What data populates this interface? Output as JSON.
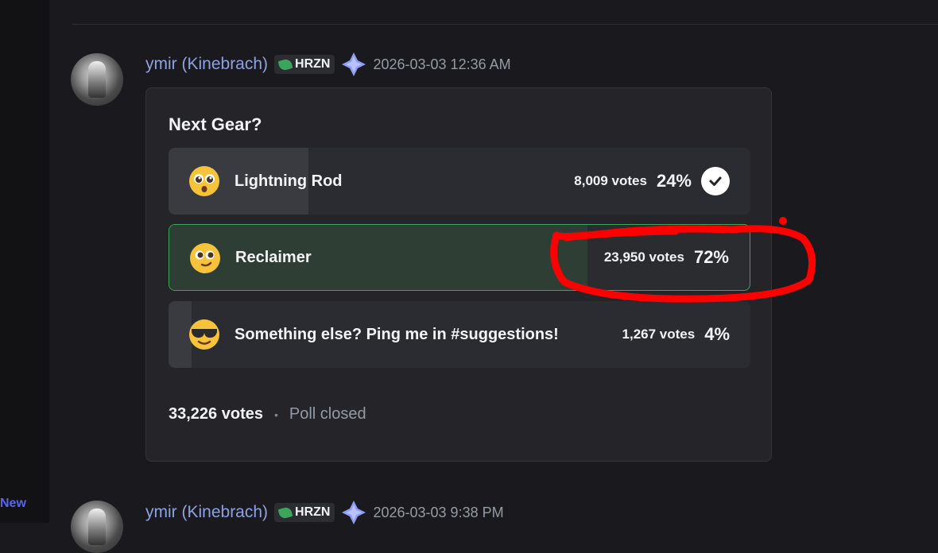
{
  "sidebar": {
    "new_label": "New"
  },
  "messages": [
    {
      "username": "ymir (Kinebrach)",
      "tag": "HRZN",
      "timestamp": "2026-03-03 12:36 AM"
    },
    {
      "username": "ymir (Kinebrach)",
      "tag": "HRZN",
      "timestamp": "2026-03-03 9:38 PM"
    }
  ],
  "poll": {
    "question": "Next Gear?",
    "answers": [
      {
        "emoji": "pleading-face-icon",
        "label": "Lightning Rod",
        "votes": "8,009 votes",
        "percent": "24%",
        "fraction": 0.24,
        "selected_by_user": true
      },
      {
        "emoji": "smiling-face-icon",
        "label": "Reclaimer",
        "votes": "23,950 votes",
        "percent": "72%",
        "fraction": 0.72,
        "winner": true
      },
      {
        "emoji": "sunglasses-face-icon",
        "label": "Something else? Ping me in #suggestions!",
        "votes": "1,267 votes",
        "percent": "4%",
        "fraction": 0.04
      }
    ],
    "total_votes": "33,226 votes",
    "separator": "•",
    "status": "Poll closed"
  },
  "colors": {
    "username": "#8ea1e1",
    "winner_border": "#3ba55c",
    "annotation": "#ff0000"
  }
}
